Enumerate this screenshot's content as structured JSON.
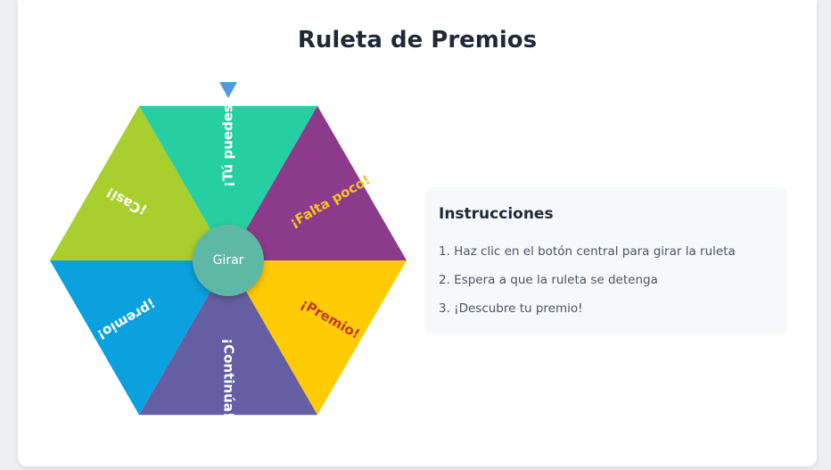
{
  "page": {
    "title": "Ruleta de Premios"
  },
  "wheel": {
    "spin_label": "Girar",
    "segments": [
      {
        "label": "¡Tú puedes!",
        "color": "#26cfa2",
        "text_color": "#ffffff"
      },
      {
        "label": "¡Falta poco!",
        "color": "#8b3a8c",
        "text_color": "#f7c51e"
      },
      {
        "label": "¡Premio!",
        "color": "#ffcb05",
        "text_color": "#c0392b"
      },
      {
        "label": "¡Continúa!",
        "color": "#655ea3",
        "text_color": "#ffffff"
      },
      {
        "label": "¡premio!",
        "color": "#0ba1df",
        "text_color": "#ffffff"
      },
      {
        "label": "¡Casi!",
        "color": "#a9cf2e",
        "text_color": "#ffffff"
      }
    ]
  },
  "instructions": {
    "heading": "Instrucciones",
    "steps": [
      "1. Haz clic en el botón central para girar la ruleta",
      "2. Espera a que la ruleta se detenga",
      "3. ¡Descubre tu premio!"
    ]
  },
  "colors": {
    "pointer": "#4a9be0",
    "spin_button": "#5fb8a6"
  }
}
